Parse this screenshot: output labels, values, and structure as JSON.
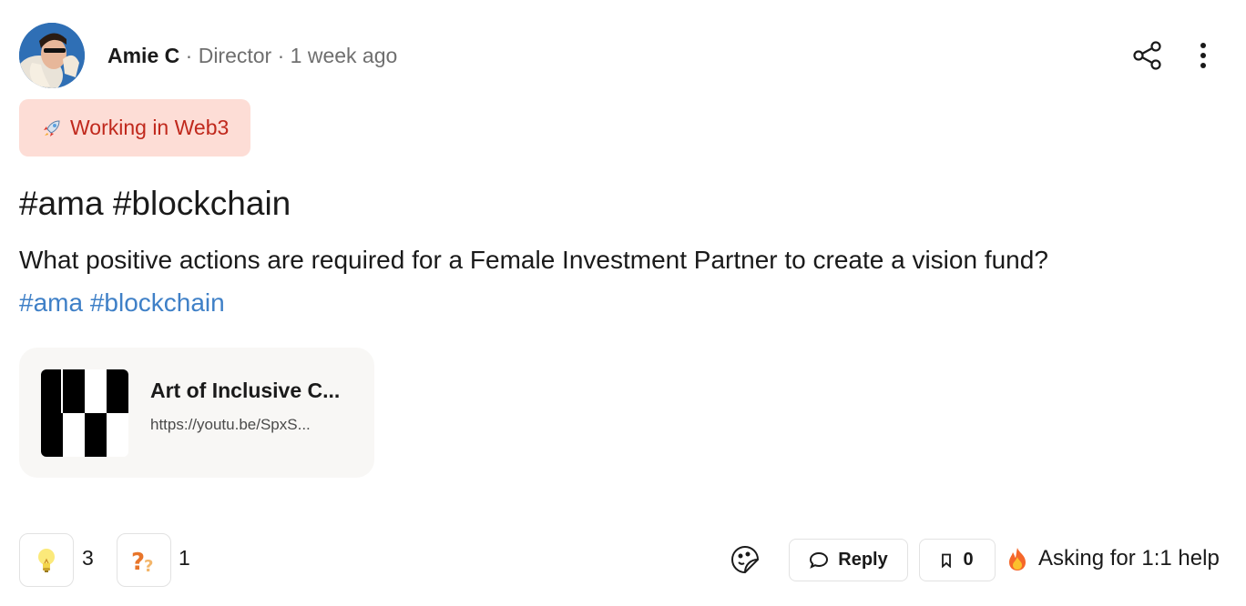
{
  "author": {
    "name": "Amie C",
    "separator1": "·",
    "role": "Director",
    "separator2": "·",
    "posted": "1 week ago"
  },
  "tag": {
    "icon": "rocket-icon",
    "label": "Working in Web3",
    "bg_color": "#fdddd6",
    "text_color": "#c0281c"
  },
  "post": {
    "title": "#ama #blockchain",
    "body": "What positive actions are required for a Female Investment Partner to create a vision fund?",
    "hashtags": [
      "#ama",
      "#blockchain"
    ],
    "hashtag_color": "#3f80c7"
  },
  "link_preview": {
    "title": "Art of Inclusive C...",
    "url": "https://youtu.be/SpxS..."
  },
  "reactions": [
    {
      "icon": "lightbulb-icon",
      "count": "3"
    },
    {
      "icon": "question-icon",
      "count": "1"
    }
  ],
  "actions": {
    "reply_label": "Reply",
    "save_count": "0",
    "asking_label": "Asking for 1:1 help",
    "asking_icon": "fire-icon"
  }
}
